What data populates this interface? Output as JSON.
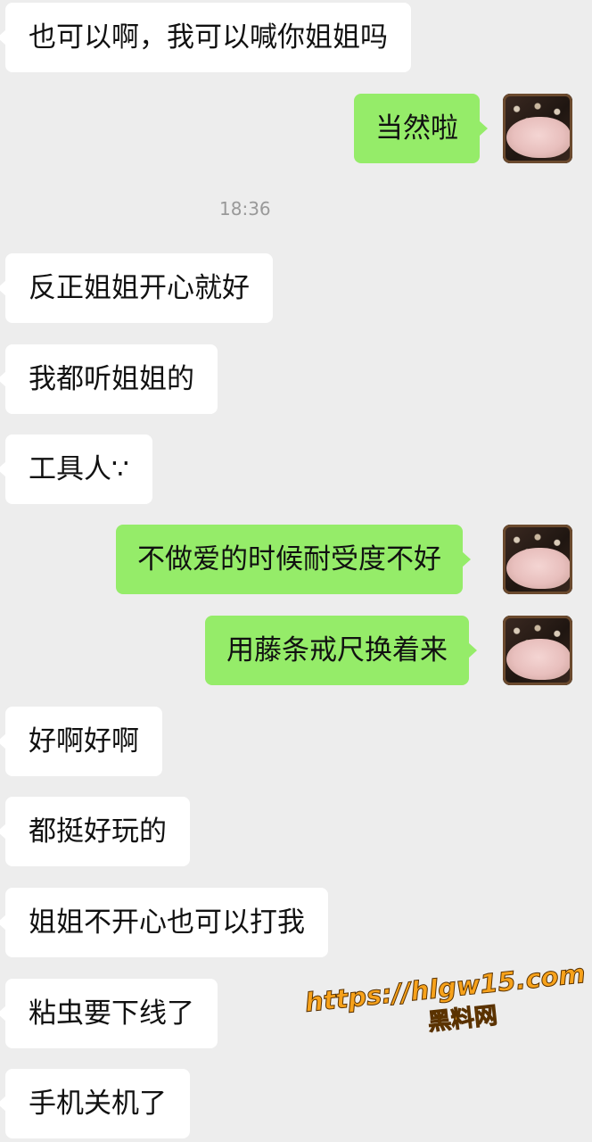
{
  "chat": {
    "messages": [
      {
        "side": "left",
        "text": "也可以啊，我可以喊你姐姐吗"
      },
      {
        "side": "right",
        "text": "当然啦"
      },
      {
        "side": "left",
        "text": "反正姐姐开心就好"
      },
      {
        "side": "left",
        "text": "我都听姐姐的"
      },
      {
        "side": "left",
        "text": "工具人∵"
      },
      {
        "side": "right",
        "text": "不做爱的时候耐受度不好"
      },
      {
        "side": "right",
        "text": "用藤条戒尺换着来"
      },
      {
        "side": "left",
        "text": "好啊好啊"
      },
      {
        "side": "left",
        "text": "都挺好玩的"
      },
      {
        "side": "left",
        "text": "姐姐不开心也可以打我"
      },
      {
        "side": "left",
        "text": "粘虫要下线了"
      },
      {
        "side": "left",
        "text": "手机关机了"
      }
    ],
    "timestamp": "18:36"
  },
  "watermark": {
    "url": "https://hlgw15.com",
    "label": "黑料网"
  },
  "colors": {
    "background": "#ededed",
    "bubble_left": "#ffffff",
    "bubble_right": "#95ec69",
    "timestamp": "#999999",
    "watermark": "#f7a21b"
  }
}
